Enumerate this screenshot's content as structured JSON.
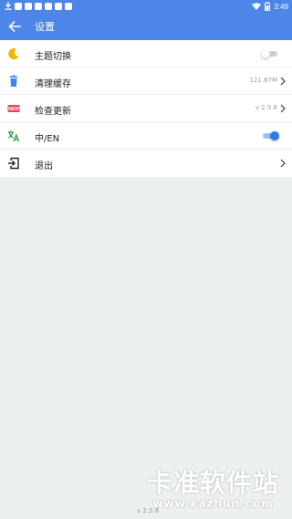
{
  "status_bar": {
    "time": "3:49",
    "left_icons": [
      "download-icon",
      "notification-icon",
      "notification-icon",
      "notification-icon",
      "notification-icon",
      "notification-icon",
      "notification-icon"
    ],
    "right_icons": [
      "wifi-icon",
      "battery-icon"
    ]
  },
  "app_bar": {
    "title": "设置",
    "back_icon": "arrow-left-icon"
  },
  "settings": [
    {
      "label": "主题切换",
      "icon": "moon-icon",
      "control": "toggle",
      "checked": false
    },
    {
      "label": "清理缓存",
      "icon": "trash-icon",
      "value": "121.67M",
      "control": "chevron"
    },
    {
      "label": "检查更新",
      "icon": "new-badge-icon",
      "icon_text": "NEW",
      "value": "v 2.5.8",
      "control": "chevron"
    },
    {
      "label": "中/EN",
      "icon": "translate-icon",
      "control": "toggle",
      "checked": true
    },
    {
      "label": "退出",
      "icon": "logout-icon",
      "control": "chevron"
    }
  ],
  "footer": {
    "version": "v 2.5.8"
  },
  "watermark": {
    "text": "卡准软件站",
    "url": "www.kazhun.com"
  },
  "colors": {
    "primary": "#4d86e8",
    "background": "#ecf0f1",
    "toggle_on": "#2f7be5"
  }
}
